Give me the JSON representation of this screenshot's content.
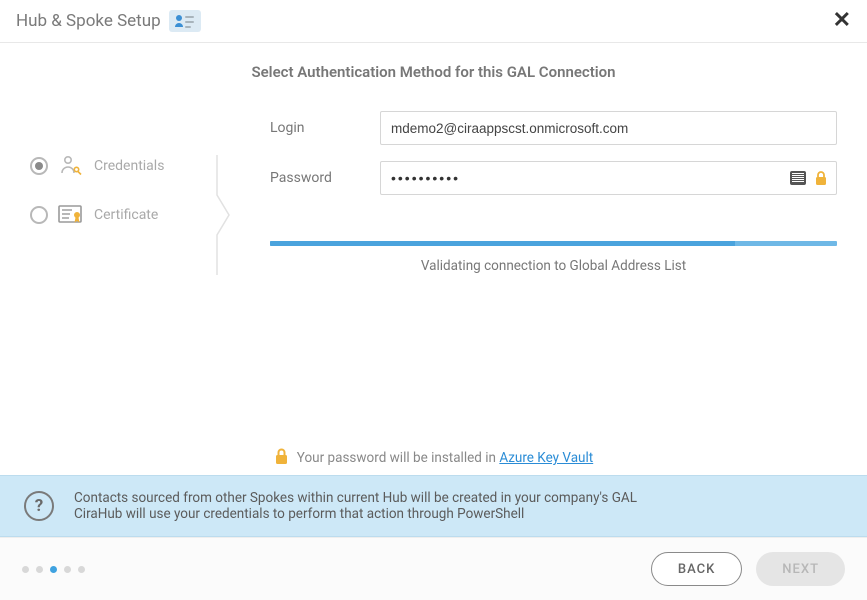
{
  "titlebar": {
    "title": "Hub & Spoke Setup"
  },
  "heading": "Select Authentication Method for this GAL Connection",
  "auth": {
    "options": [
      {
        "label": "Credentials",
        "selected": true
      },
      {
        "label": "Certificate",
        "selected": false
      }
    ]
  },
  "form": {
    "login_label": "Login",
    "login_value": "mdemo2@ciraappscst.onmicrosoft.com",
    "password_label": "Password",
    "password_value": "••••••••••"
  },
  "progress": {
    "label": "Validating connection to Global Address List"
  },
  "pw_note": {
    "prefix": "Your password will be installed in ",
    "link": "Azure Key Vault"
  },
  "info": {
    "line1": "Contacts sourced from other Spokes within current Hub will be created in your company's GAL",
    "line2": "CiraHub will use your credentials to perform that action through PowerShell"
  },
  "footer": {
    "back": "BACK",
    "next": "NEXT"
  }
}
